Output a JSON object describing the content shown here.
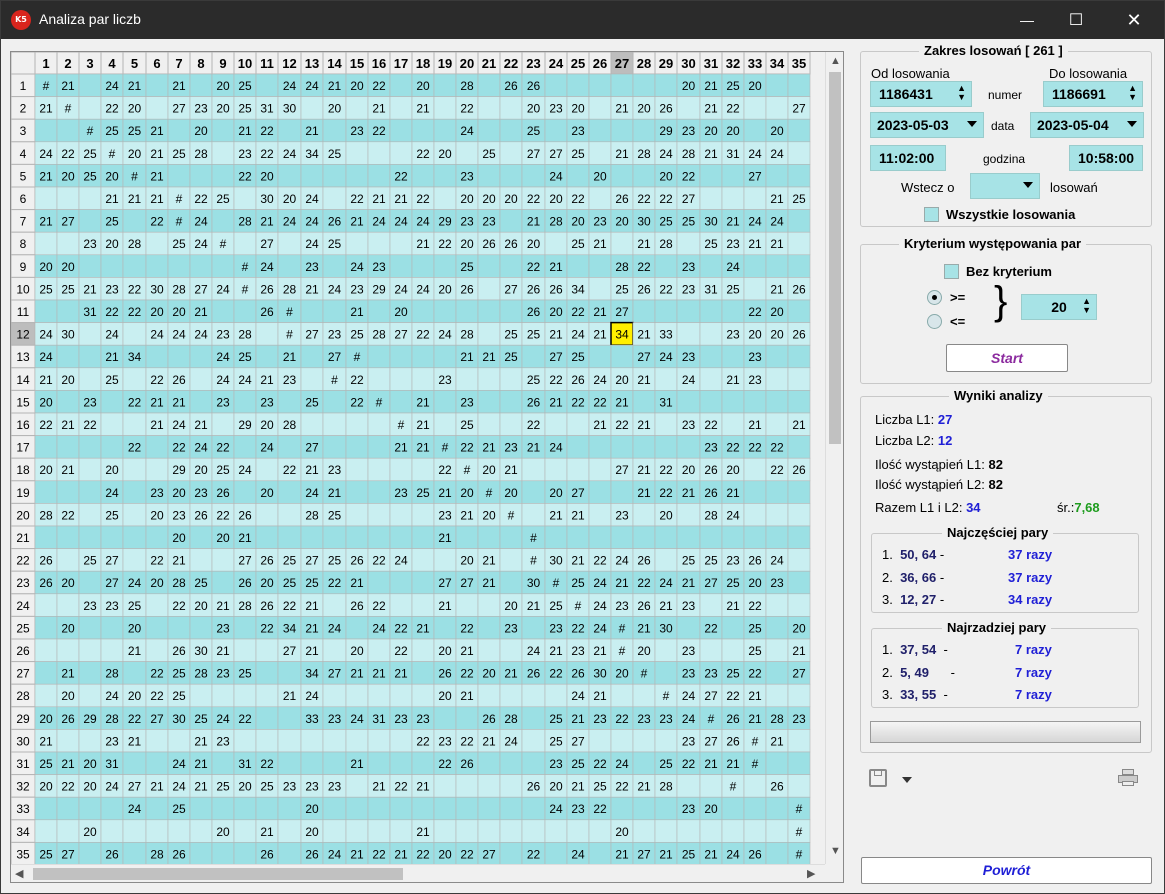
{
  "window": {
    "title": "Analiza par liczb",
    "icon_text": "K5",
    "minimize": "—",
    "maximize": "☐",
    "close": "✕"
  },
  "grid": {
    "columns": [
      "1",
      "2",
      "3",
      "4",
      "5",
      "6",
      "7",
      "8",
      "9",
      "10",
      "11",
      "12",
      "13",
      "14",
      "15",
      "16",
      "17",
      "18",
      "19",
      "20",
      "21",
      "22",
      "23",
      "24",
      "25",
      "26",
      "27",
      "28",
      "29",
      "30",
      "31",
      "32",
      "33",
      "34",
      "35"
    ],
    "selected_col": 27,
    "selected_row": 12,
    "highlighted_cell_value": "34",
    "rows": [
      "#|21||24|21||21||20|25||24|24|21|20|22||20||28||26|26|||||||20|21|25|20|||25",
      "21|#||22|20||27|23|20|25|31|30||20||21||21||22|||20|23|20||21|20|26||21|22|||27",
      "||#|25|25|21||20||21|22||21||23|22||||24|||25||23||||29|23|20|20||20|",
      "24|22|25|#|20|21|25|28||23|22|24|34|25||||22|20||25||27|27|25||21|28|24|28|21|31|24|24||26",
      "21|20|25|20|#|21||||22|20||||||22|||23||||24||20|||20|22|||27|||",
      "|||21|21|21|#|22|25||30|20|24||22|21|21|22||20|20|20|22|20|22||26|22|22|27||||21|25||28",
      "21|27||25||22|#|24||28|21|24|24|26|21|24|24|24|29|23|23||21|28|20|23|20|30|25|25|30|21|24|24||",
      "||23|20|28||25|24|#||27||24|25||||21|22|20|26|26|20||25|21||21|28||25|23|21|21||20||",
      "20|20||||||||#|24||23||24|23||||25|||22|21|||28|22||23||24|||||||",
      "25|25|21|23|22|30|28|27|24|#|26|28|21|24|23|29|24|24|20|26||27|26|26|34||25|26|22|23|31|25||21|26",
      "||31|22|22|20|20|21|||26|#|||21||20||||||26|20|22|21|27||||||22|20|||",
      "24|30||24||24|24|24|23|28||#|27|23|25|28|27|22|24|28||25|25|21|24|21|34|21|33|||23|20|20|26",
      "24|||21|34||||24|25||21||27|#|||||21|21|25||27|25|||27|24|23|||23|||24",
      "21|20||25||22|26||24|24|21|23||#|22||||23||||25|22|26|24|20|21||24||21|23||",
      "20||23||22|21|21||23||23||25||22|#||21||23|||26|21|22|22|21||31|||||",
      "22|21|22|||21|24|21||29|20|28|||||#|21||25|||22|||21|22|21||23|22||21||21|21",
      "||||22||22|24|22||24||27||||21|21|#|22|21|23|21|24|||||||23|22|22|22|||",
      "20|21||20|||29|20|25|24||22|21|23|||||22|#|20|21|||||27|21|22|20|26|20||22|26|21||",
      "|||24||23|20|23|26||20||24|21|||23|25|21|20|#|20||20|27|||21|22|21|26|21||||||",
      "28|22||25||20|23|26|22|26|||28|25|||||23|21|20|#||21|21||23||20||28|24||||",
      "||||||20||20|21|||||||||21||||#|||||||||||||",
      "26||25|27||22|21|||27|26|25|27|25|26|22|24|||20|21||#|30|21|22|24|26||25|25|23|26|24||22",
      "26|20||27|24|20|28|25||26|20|25|25|22|21||||27|27|21||30|#|25|24|21|22|24|21|27|25|20|23||",
      "||23|23|25||22|20|21|28|26|22|21||26|22|||21|||20|21|25|#|24|23|26|21|23||21|22|||24",
      "|20|||20||||23||22|34|21|24||24|22|21||22||23||23|22|24|#|21|30||22||25||20|",
      "||||21||26|30|21|||27|21||20||22||20|21|||24|21|23|21|#|20||23|||25||21",
      "|21||28||22|25|28|23|25|||34|27|21|21|21||26|22|20|21|26|22|26|30|20|#||23|23|25|22||27",
      "|20||24|20|22|25|||||21|24||||||20|21|||||24|21|||#|24|27|22|21|||",
      "20|26|29|28|22|27|30|25|24|22|||33|23|24|31|23|23|||26|28||25|21|23|22|23|23|24|#|26|21|28|23|25",
      "21|||23|21|||21|23|||||||||22|23|22|21|24||25|27|||||23|27|26|#|21||21|21",
      "25|21|20|31|||24|21||31|22||||21||||22|26||||23|25|22|24||25|22|21|21|#|||",
      "20|22|20|24|27|21|24|21|25|20|25|23|23|23||21|22|21|||||26|20|21|25|22|21|28|||#||26",
      "||||24||25||||||20|||||||||||24|23|22||||23|20||||#|",
      "||20||||||20||21||20|||||21|||||||||20||||||||#",
      "25|27||26||28|26||||26||26|24|21|22|21|22|20|22|27||22||24||21|27|21|25|21|24|26||#"
    ]
  },
  "zakres": {
    "title": "Zakres losowań  [ 261 ]",
    "od_label": "Od losowania",
    "do_label": "Do losowania",
    "od_numer": "1186431",
    "do_numer": "1186691",
    "numer_label": "numer",
    "od_data": "2023-05-03",
    "do_data": "2023-05-04",
    "data_label": "data",
    "od_godzina": "11:02:00",
    "do_godzina": "10:58:00",
    "godzina_label": "godzina",
    "wstecz_label": "Wstecz o",
    "wstecz_value": "",
    "losowan_label": "losowań",
    "wszystkie_label": "Wszystkie losowania"
  },
  "kryterium": {
    "title": "Kryterium występowania par",
    "bez_label": "Bez kryterium",
    "ge_label": ">=",
    "le_label": "<=",
    "brace": "}",
    "value": "20",
    "start_label": "Start"
  },
  "wyniki": {
    "title": "Wyniki analizy",
    "l1_label": "Liczba L1:",
    "l1_value": "27",
    "l2_label": "Liczba L2:",
    "l2_value": "12",
    "il1_label": "Ilość wystąpień L1:",
    "il1_value": "82",
    "il2_label": "Ilość wystąpień L2:",
    "il2_value": "82",
    "razem_label": "Razem L1 i L2:",
    "razem_value": "34",
    "sr_label": "śr.:",
    "sr_value": "7,68",
    "najczesciej_title": "Najczęściej pary",
    "najczesciej": [
      {
        "n": "1.",
        "pair": "50, 64",
        "dash": "-",
        "count": "37 razy"
      },
      {
        "n": "2.",
        "pair": "36, 66",
        "dash": "-",
        "count": "37 razy"
      },
      {
        "n": "3.",
        "pair": "12, 27",
        "dash": "-",
        "count": "34 razy"
      }
    ],
    "najrzadziej_title": "Najrzadziej pary",
    "najrzadziej": [
      {
        "n": "1.",
        "pair": "37, 54",
        "dash": "-",
        "count": "7 razy"
      },
      {
        "n": "2.",
        "pair": "5, 49",
        "dash": "-",
        "count": "7 razy"
      },
      {
        "n": "3.",
        "pair": "33, 55",
        "dash": "-",
        "count": "7 razy"
      }
    ]
  },
  "bottom": {
    "powrot_label": "Powrót"
  },
  "colors": {
    "row_dark": "#9be0e4",
    "row_light": "#c9eff1",
    "header": "#f0f0f0",
    "highlight": "#ffef00",
    "accent_blue": "#1f1fd6",
    "start_purple": "#8b2a9e"
  }
}
